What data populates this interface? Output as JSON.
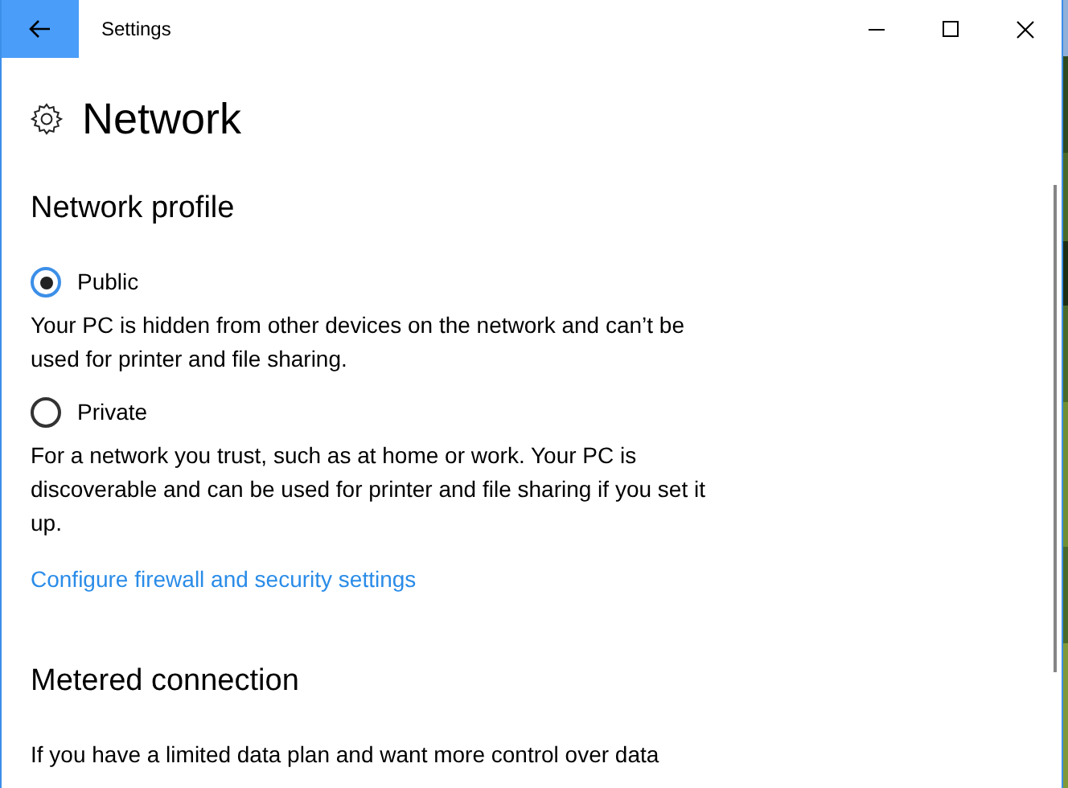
{
  "window": {
    "title": "Settings"
  },
  "page": {
    "title": "Network"
  },
  "sections": [
    {
      "heading": "Network profile",
      "options": [
        {
          "label": "Public",
          "selected": true,
          "description": "Your PC is hidden from other devices on the network and can’t be used for printer and file sharing."
        },
        {
          "label": "Private",
          "selected": false,
          "description": "For a network you trust, such as at home or work. Your PC is discoverable and can be used for printer and file sharing if you set it up."
        }
      ],
      "link": "Configure firewall and security settings"
    },
    {
      "heading": "Metered connection",
      "text": "If you have a limited data plan and want more control over data"
    }
  ]
}
